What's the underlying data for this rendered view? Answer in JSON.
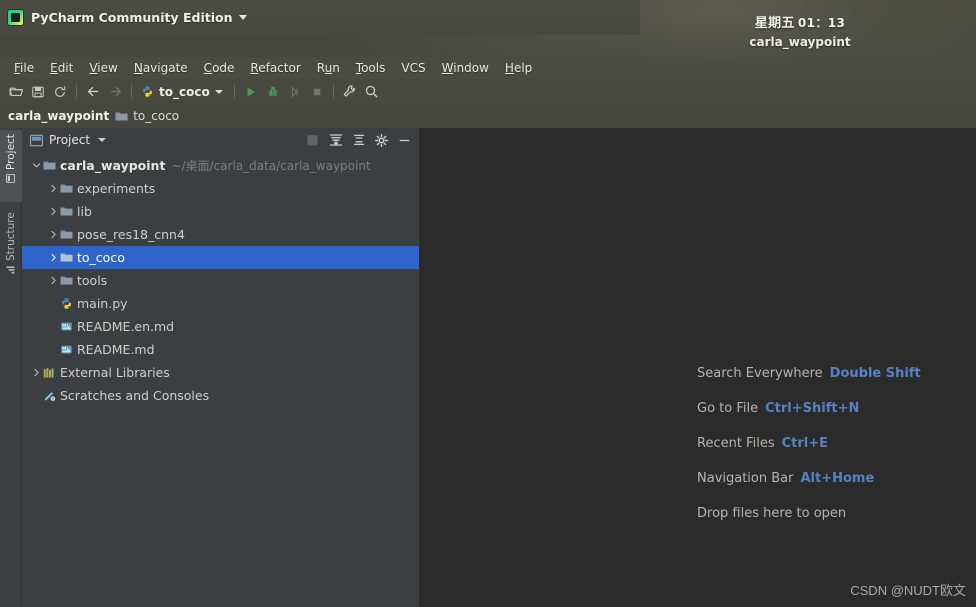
{
  "desktop": {
    "ghost_text": "",
    "clock_weekday": "星期五",
    "clock_time": "01：13",
    "session_name": "carla_waypoint"
  },
  "titlebar": {
    "app_title": "PyCharm Community Edition",
    "logo_icon": "pycharm-logo-icon",
    "caret_icon": "chevron-down-icon"
  },
  "menubar": {
    "items": [
      {
        "label": "File",
        "mnemonic": "F",
        "rest": "ile"
      },
      {
        "label": "Edit",
        "mnemonic": "E",
        "rest": "dit"
      },
      {
        "label": "View",
        "mnemonic": "V",
        "rest": "iew"
      },
      {
        "label": "Navigate",
        "mnemonic": "N",
        "rest": "avigate"
      },
      {
        "label": "Code",
        "mnemonic": "C",
        "rest": "ode"
      },
      {
        "label": "Refactor",
        "mnemonic": "R",
        "rest": "efactor"
      },
      {
        "label": "Run",
        "mnemonic": "Ru",
        "rest": "n",
        "pre": "R",
        "mid": "u",
        "post": "n"
      },
      {
        "label": "Tools",
        "mnemonic": "T",
        "rest": "ools"
      },
      {
        "label": "VCS",
        "mnemonic": "",
        "rest": "VCS"
      },
      {
        "label": "Window",
        "mnemonic": "W",
        "rest": "indow"
      },
      {
        "label": "Help",
        "mnemonic": "H",
        "rest": "elp"
      }
    ]
  },
  "toolbar": {
    "open_icon": "open-folder-icon",
    "save_icon": "save-icon",
    "sync_icon": "refresh-sync-icon",
    "back_icon": "arrow-left-icon",
    "forward_icon": "arrow-right-icon",
    "run_config_icon": "python-config-icon",
    "run_config_label": "to_coco",
    "run_config_caret": "chevron-down-icon",
    "run_icon": "run-play-icon",
    "debug_icon": "debug-bug-icon",
    "coverage_icon": "run-with-coverage-icon",
    "stop_icon": "stop-square-icon",
    "settings_icon": "wrench-settings-icon",
    "search_icon": "search-icon",
    "accent_run_green": "#499c54",
    "accent_debug_green": "#4e9a57"
  },
  "navbar": {
    "crumbs": [
      {
        "label": "carla_waypoint",
        "icon": ""
      },
      {
        "label": "to_coco",
        "icon": "folder-icon"
      }
    ]
  },
  "stripe": {
    "tabs": [
      {
        "label": "Project",
        "icon": "project-icon",
        "active": true
      },
      {
        "label": "Structure",
        "icon": "structure-icon",
        "active": false
      }
    ]
  },
  "project_panel": {
    "title": "Project",
    "title_icon": "project-window-icon",
    "title_caret": "chevron-down-icon",
    "actions": [
      {
        "name": "expand-all-icon",
        "dim": true
      },
      {
        "name": "select-opened-file-icon",
        "dim": false
      },
      {
        "name": "collapse-all-icon",
        "dim": false
      },
      {
        "name": "gear-icon",
        "dim": false
      },
      {
        "name": "hide-panel-icon",
        "dim": false
      }
    ],
    "selected_color": "#2f65ca",
    "tree": [
      {
        "label": "carla_waypoint",
        "path": "~/桌面/carla_data/carla_waypoint",
        "icon": "folder-icon",
        "indent": 0,
        "twisty": "expanded",
        "bold": true,
        "selected": false
      },
      {
        "label": "experiments",
        "path": "",
        "icon": "folder-icon",
        "indent": 1,
        "twisty": "collapsed",
        "bold": false,
        "selected": false
      },
      {
        "label": "lib",
        "path": "",
        "icon": "folder-icon",
        "indent": 1,
        "twisty": "collapsed",
        "bold": false,
        "selected": false
      },
      {
        "label": "pose_res18_cnn4",
        "path": "",
        "icon": "folder-icon",
        "indent": 1,
        "twisty": "collapsed",
        "bold": false,
        "selected": false
      },
      {
        "label": "to_coco",
        "path": "",
        "icon": "folder-icon",
        "indent": 1,
        "twisty": "collapsed",
        "bold": false,
        "selected": true
      },
      {
        "label": "tools",
        "path": "",
        "icon": "folder-icon",
        "indent": 1,
        "twisty": "collapsed",
        "bold": false,
        "selected": false
      },
      {
        "label": "main.py",
        "path": "",
        "icon": "python-file-icon",
        "indent": 1,
        "twisty": "none",
        "bold": false,
        "selected": false
      },
      {
        "label": "README.en.md",
        "path": "",
        "icon": "markdown-file-icon",
        "indent": 1,
        "twisty": "none",
        "bold": false,
        "selected": false
      },
      {
        "label": "README.md",
        "path": "",
        "icon": "markdown-file-icon",
        "indent": 1,
        "twisty": "none",
        "bold": false,
        "selected": false
      },
      {
        "label": "External Libraries",
        "path": "",
        "icon": "libraries-icon",
        "indent": 0,
        "twisty": "collapsed",
        "bold": false,
        "selected": false
      },
      {
        "label": "Scratches and Consoles",
        "path": "",
        "icon": "scratches-icon",
        "indent": 0,
        "twisty": "none",
        "bold": false,
        "selected": false
      }
    ]
  },
  "editor": {
    "tips": [
      {
        "label": "Search Everywhere",
        "key": "Double Shift"
      },
      {
        "label": "Go to File",
        "key": "Ctrl+Shift+N"
      },
      {
        "label": "Recent Files",
        "key": "Ctrl+E"
      },
      {
        "label": "Navigation Bar",
        "key": "Alt+Home"
      }
    ],
    "drop_hint": "Drop files here to open",
    "key_color": "#5781c4"
  },
  "watermark": {
    "text": "CSDN @NUDT欧文"
  }
}
